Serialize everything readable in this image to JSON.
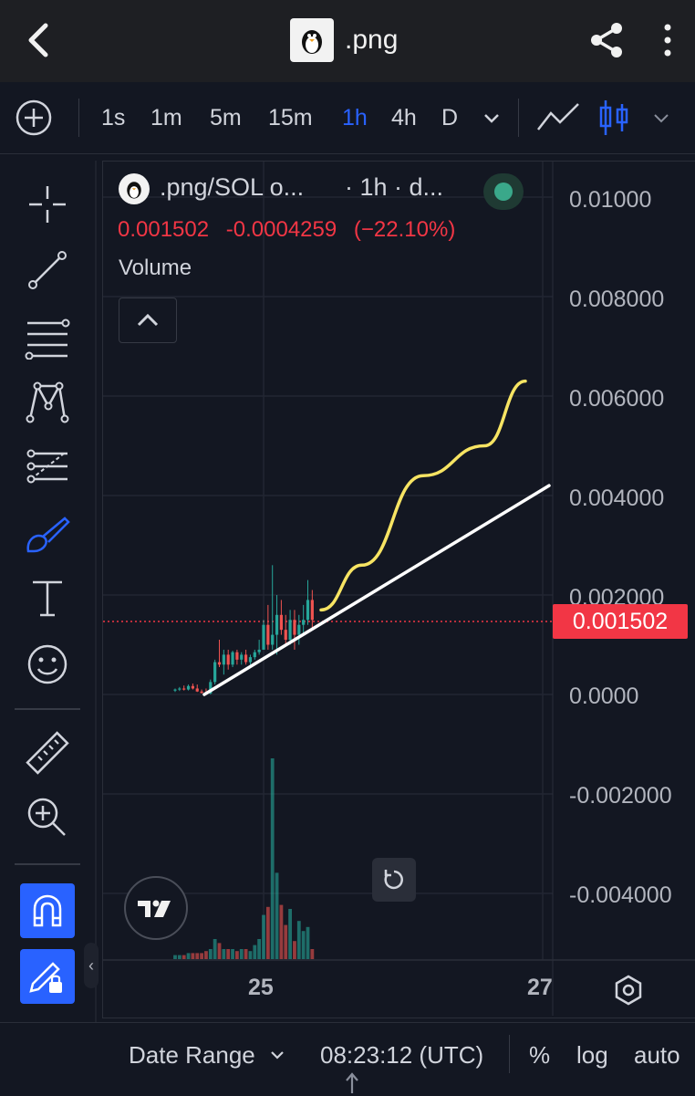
{
  "app_bar": {
    "title": ".png",
    "back_icon": "chevron-left-icon",
    "share_icon": "share-icon",
    "menu_icon": "kebab-menu-icon"
  },
  "toolbar": {
    "add_icon": "plus-circle-icon",
    "intervals": [
      "1s",
      "1m",
      "5m",
      "15m",
      "1h",
      "4h",
      "D"
    ],
    "active_interval": "1h",
    "chart_type_icons": [
      "line-chart-icon",
      "candlestick-icon"
    ]
  },
  "legend": {
    "symbol": ".png/SOL o...",
    "interval": "· 1h · d...",
    "last": "0.001502",
    "change": "-0.0004259",
    "change_pct": "(−22.10%)",
    "volume_label": "Volume",
    "status_color": "#3aa88a"
  },
  "price_scale": {
    "ticks": [
      "0.01000",
      "0.008000",
      "0.006000",
      "0.004000",
      "0.002000",
      "0.0000",
      "-0.002000",
      "-0.004000"
    ],
    "current_price": "0.001502",
    "current_price_color": "#f23645"
  },
  "time_scale": {
    "ticks": [
      "25",
      "27"
    ]
  },
  "bottom_bar": {
    "date_range": "Date Range",
    "time": "08:23:12 (UTC)",
    "percent": "%",
    "log": "log",
    "auto": "auto"
  },
  "colors": {
    "up": "#26a69a",
    "down": "#ef5350",
    "accent": "#2962ff",
    "trend_line": "#ffffff",
    "drawing": "#f7e463"
  },
  "chart_data": {
    "type": "candlestick",
    "interval": "1h",
    "ylim": [
      -0.005,
      0.0105
    ],
    "x_ticks": [
      "25",
      "27"
    ],
    "last_price": 0.001502,
    "candles": [
      {
        "o": 8e-05,
        "h": 0.00012,
        "l": 5e-05,
        "c": 0.0001,
        "v": 0.02
      },
      {
        "o": 0.0001,
        "h": 0.00015,
        "l": 7e-05,
        "c": 0.00012,
        "v": 0.02
      },
      {
        "o": 0.00012,
        "h": 0.00018,
        "l": 8e-05,
        "c": 0.0001,
        "v": 0.02
      },
      {
        "o": 0.0001,
        "h": 0.0002,
        "l": 8e-05,
        "c": 0.00017,
        "v": 0.03
      },
      {
        "o": 0.00017,
        "h": 0.00022,
        "l": 0.0001,
        "c": 0.00012,
        "v": 0.03
      },
      {
        "o": 0.00012,
        "h": 0.0002,
        "l": 5e-05,
        "c": 6e-05,
        "v": 0.03
      },
      {
        "o": 6e-05,
        "h": 0.0001,
        "l": 2e-05,
        "c": 3e-05,
        "v": 0.03
      },
      {
        "o": 3e-05,
        "h": 0.00012,
        "l": 0.0,
        "c": 2e-05,
        "v": 0.04
      },
      {
        "o": 2e-05,
        "h": 0.0003,
        "l": 0.0,
        "c": 0.00025,
        "v": 0.05
      },
      {
        "o": 0.00025,
        "h": 0.0007,
        "l": 0.0002,
        "c": 0.00065,
        "v": 0.1
      },
      {
        "o": 0.00065,
        "h": 0.0011,
        "l": 0.00055,
        "c": 0.0006,
        "v": 0.08
      },
      {
        "o": 0.0006,
        "h": 0.0009,
        "l": 0.0004,
        "c": 0.0008,
        "v": 0.05
      },
      {
        "o": 0.0008,
        "h": 0.0009,
        "l": 0.0005,
        "c": 0.0006,
        "v": 0.05
      },
      {
        "o": 0.0006,
        "h": 0.00088,
        "l": 0.00055,
        "c": 0.00085,
        "v": 0.05
      },
      {
        "o": 0.00085,
        "h": 0.0009,
        "l": 0.0006,
        "c": 0.0007,
        "v": 0.04
      },
      {
        "o": 0.0007,
        "h": 0.00085,
        "l": 0.0006,
        "c": 0.0008,
        "v": 0.05
      },
      {
        "o": 0.0008,
        "h": 0.0009,
        "l": 0.0006,
        "c": 0.00065,
        "v": 0.05
      },
      {
        "o": 0.00065,
        "h": 0.0008,
        "l": 0.0006,
        "c": 0.00075,
        "v": 0.04
      },
      {
        "o": 0.00075,
        "h": 0.0009,
        "l": 0.0007,
        "c": 0.00085,
        "v": 0.07
      },
      {
        "o": 0.00085,
        "h": 0.0011,
        "l": 0.0008,
        "c": 0.0009,
        "v": 0.1
      },
      {
        "o": 0.0009,
        "h": 0.0015,
        "l": 0.0009,
        "c": 0.0014,
        "v": 0.22
      },
      {
        "o": 0.0014,
        "h": 0.0018,
        "l": 0.0009,
        "c": 0.001,
        "v": 0.26
      },
      {
        "o": 0.001,
        "h": 0.0026,
        "l": 0.0009,
        "c": 0.0012,
        "v": 1.0
      },
      {
        "o": 0.0012,
        "h": 0.002,
        "l": 0.0008,
        "c": 0.0016,
        "v": 0.43
      },
      {
        "o": 0.0016,
        "h": 0.0019,
        "l": 0.0012,
        "c": 0.0013,
        "v": 0.27
      },
      {
        "o": 0.0013,
        "h": 0.0016,
        "l": 0.001,
        "c": 0.0011,
        "v": 0.17
      },
      {
        "o": 0.0011,
        "h": 0.0017,
        "l": 0.001,
        "c": 0.0015,
        "v": 0.25
      },
      {
        "o": 0.0015,
        "h": 0.0017,
        "l": 0.0009,
        "c": 0.0012,
        "v": 0.09
      },
      {
        "o": 0.0012,
        "h": 0.0016,
        "l": 0.001,
        "c": 0.0014,
        "v": 0.19
      },
      {
        "o": 0.0014,
        "h": 0.0018,
        "l": 0.0012,
        "c": 0.0015,
        "v": 0.14
      },
      {
        "o": 0.0015,
        "h": 0.0023,
        "l": 0.0014,
        "c": 0.0019,
        "v": 0.16
      },
      {
        "o": 0.0019,
        "h": 0.0021,
        "l": 0.0013,
        "c": 0.0015,
        "v": 0.05
      }
    ],
    "drawings": [
      {
        "type": "trend_line",
        "color": "#ffffff",
        "points": [
          [
            0.0,
            0.0
          ],
          [
            1.0,
            0.0042
          ]
        ]
      },
      {
        "type": "brush",
        "color": "#f7e463",
        "points": [
          [
            0.0,
            0.0017
          ],
          [
            0.2,
            0.0026
          ],
          [
            0.5,
            0.0044
          ],
          [
            0.8,
            0.005
          ],
          [
            1.0,
            0.0063
          ]
        ]
      }
    ]
  }
}
